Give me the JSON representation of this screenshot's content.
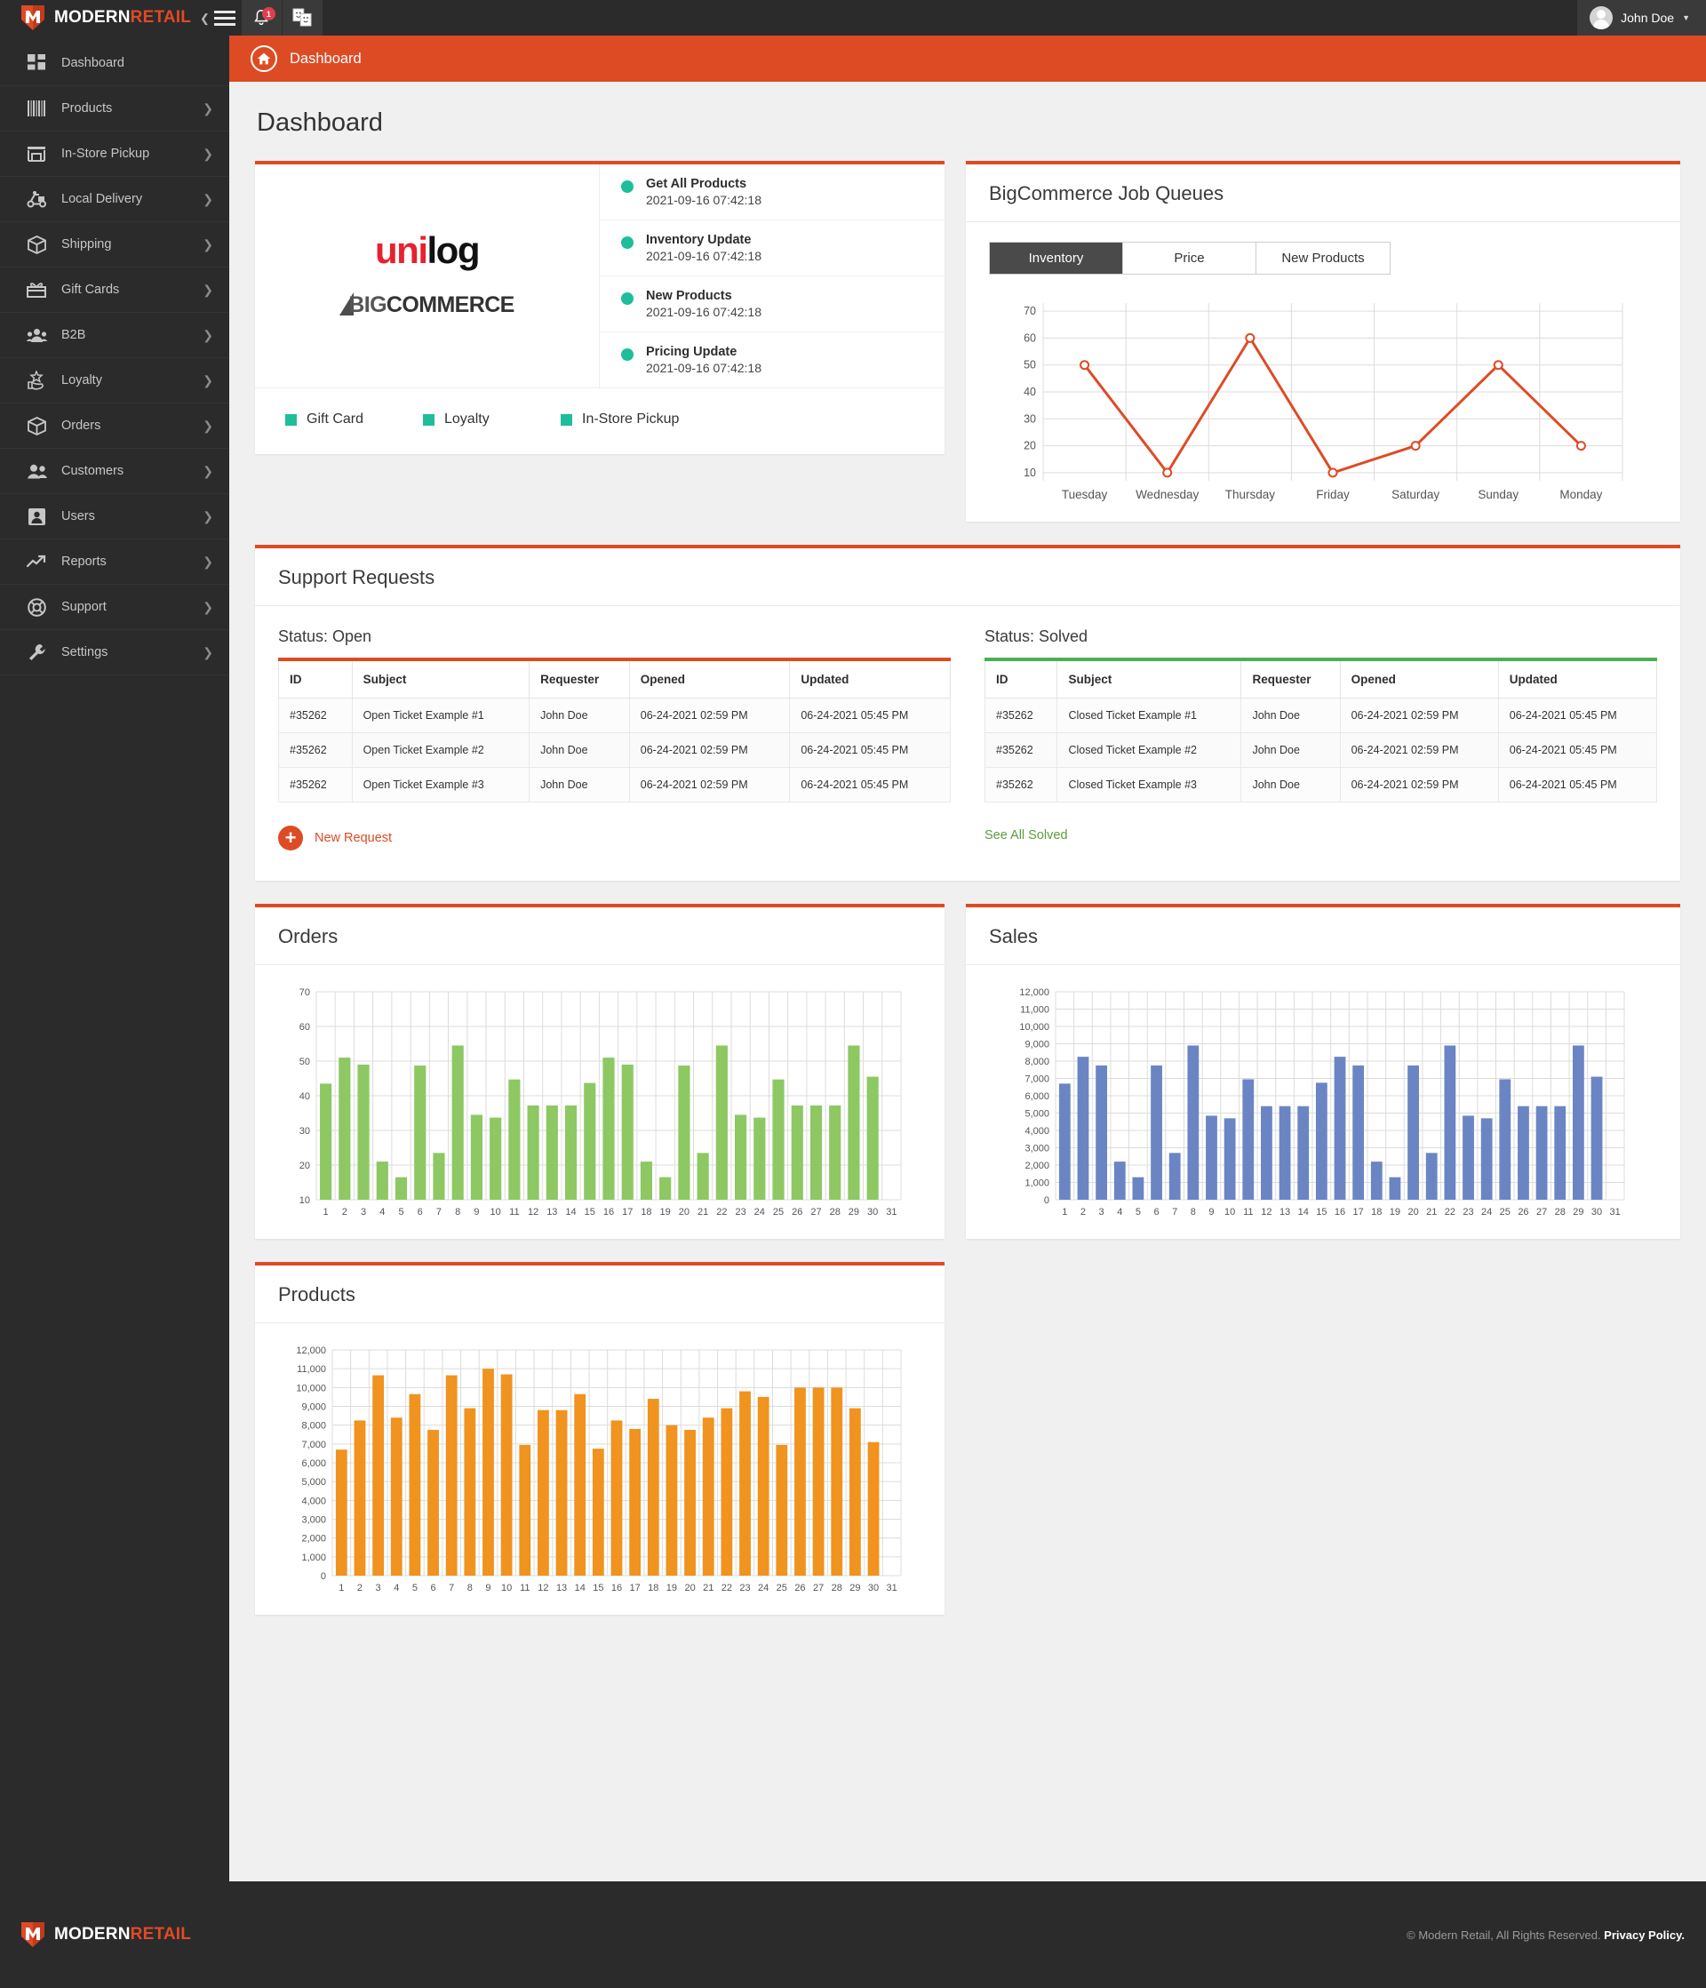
{
  "brand": {
    "word1": "MODERN",
    "word2": "RETAIL"
  },
  "topbar": {
    "notification_count": "1",
    "user_name": "John Doe",
    "notification_icon": "bell-icon",
    "apps_icon": "faces-icon",
    "menu_icon": "hamburger-icon"
  },
  "breadcrumb": {
    "label": "Dashboard"
  },
  "page": {
    "title": "Dashboard"
  },
  "sidebar": {
    "items": [
      {
        "label": "Dashboard",
        "icon": "grid-icon",
        "has_chevron": false
      },
      {
        "label": "Products",
        "icon": "barcode-icon",
        "has_chevron": true
      },
      {
        "label": "In-Store Pickup",
        "icon": "store-icon",
        "has_chevron": true
      },
      {
        "label": "Local Delivery",
        "icon": "scooter-icon",
        "has_chevron": true
      },
      {
        "label": "Shipping",
        "icon": "box-icon",
        "has_chevron": true
      },
      {
        "label": "Gift Cards",
        "icon": "gift-icon",
        "has_chevron": true
      },
      {
        "label": "B2B",
        "icon": "group-icon",
        "has_chevron": true
      },
      {
        "label": "Loyalty",
        "icon": "star-hand-icon",
        "has_chevron": true
      },
      {
        "label": "Orders",
        "icon": "package-icon",
        "has_chevron": true
      },
      {
        "label": "Customers",
        "icon": "people-icon",
        "has_chevron": true
      },
      {
        "label": "Users",
        "icon": "user-card-icon",
        "has_chevron": true
      },
      {
        "label": "Reports",
        "icon": "trend-up-icon",
        "has_chevron": true
      },
      {
        "label": "Support",
        "icon": "lifebuoy-icon",
        "has_chevron": true
      },
      {
        "label": "Settings",
        "icon": "wrench-icon",
        "has_chevron": true
      }
    ]
  },
  "status_card": {
    "logo_unilog_a": "uni",
    "logo_unilog_b": "log",
    "logo_bigcommerce_light": "BIG",
    "logo_bigcommerce_bold": "COMMERCE",
    "jobs": [
      {
        "name": "Get All Products",
        "time": "2021-09-16 07:42:18",
        "status_color": "#1fbe9a"
      },
      {
        "name": "Inventory Update",
        "time": "2021-09-16 07:42:18",
        "status_color": "#1fbe9a"
      },
      {
        "name": "New Products",
        "time": "2021-09-16 07:42:18",
        "status_color": "#1fbe9a"
      },
      {
        "name": "Pricing Update",
        "time": "2021-09-16 07:42:18",
        "status_color": "#1fbe9a"
      }
    ],
    "legend": [
      {
        "label": "Gift Card",
        "color": "#1fbe9a"
      },
      {
        "label": "Loyalty",
        "color": "#1fbe9a"
      },
      {
        "label": "In-Store Pickup",
        "color": "#1fbe9a"
      }
    ]
  },
  "job_queues": {
    "title": "BigCommerce Job Queues",
    "tabs": [
      {
        "label": "Inventory",
        "active": true
      },
      {
        "label": "Price",
        "active": false
      },
      {
        "label": "New Products",
        "active": false
      }
    ]
  },
  "support": {
    "title": "Support Requests",
    "open": {
      "status_label": "Status: Open",
      "columns": [
        "ID",
        "Subject",
        "Requester",
        "Opened",
        "Updated"
      ],
      "rows": [
        {
          "id": "#35262",
          "subject": "Open Ticket Example #1",
          "requester": "John Doe",
          "opened": "06-24-2021  02:59 PM",
          "updated": "06-24-2021  05:45 PM"
        },
        {
          "id": "#35262",
          "subject": "Open Ticket Example #2",
          "requester": "John Doe",
          "opened": "06-24-2021  02:59 PM",
          "updated": "06-24-2021  05:45 PM"
        },
        {
          "id": "#35262",
          "subject": "Open Ticket Example #3",
          "requester": "John Doe",
          "opened": "06-24-2021  02:59 PM",
          "updated": "06-24-2021  05:45 PM"
        }
      ],
      "action_label": "New Request"
    },
    "solved": {
      "status_label": "Status: Solved",
      "columns": [
        "ID",
        "Subject",
        "Requester",
        "Opened",
        "Updated"
      ],
      "rows": [
        {
          "id": "#35262",
          "subject": "Closed Ticket Example #1",
          "requester": "John Doe",
          "opened": "06-24-2021  02:59 PM",
          "updated": "06-24-2021  05:45 PM"
        },
        {
          "id": "#35262",
          "subject": "Closed Ticket Example #2",
          "requester": "John Doe",
          "opened": "06-24-2021  02:59 PM",
          "updated": "06-24-2021  05:45 PM"
        },
        {
          "id": "#35262",
          "subject": "Closed Ticket Example #3",
          "requester": "John Doe",
          "opened": "06-24-2021  02:59 PM",
          "updated": "06-24-2021  05:45 PM"
        }
      ],
      "action_label": "See All Solved"
    }
  },
  "sections": {
    "orders_title": "Orders",
    "sales_title": "Sales",
    "products_title": "Products"
  },
  "footer": {
    "copy": "© Modern Retail, All Rights Reserved.",
    "privacy": "Privacy Policy."
  },
  "colors": {
    "accent": "#dd4b25",
    "green": "#4caf50",
    "teal": "#1fbe9a",
    "orders_bar": "#8dc863",
    "sales_bar": "#6b85c4",
    "products_bar": "#f0931f",
    "line": "#dd4b25"
  },
  "chart_data": [
    {
      "id": "job_queues_line",
      "type": "line",
      "title": "BigCommerce Job Queues",
      "series_name": "Inventory",
      "categories": [
        "Tuesday",
        "Wednesday",
        "Thursday",
        "Friday",
        "Saturday",
        "Sunday",
        "Monday"
      ],
      "values": [
        50,
        10,
        60,
        10,
        20,
        50,
        20
      ],
      "yticks": [
        10,
        20,
        30,
        40,
        50,
        60,
        70
      ],
      "ylim": [
        7,
        73
      ],
      "xlabel": "",
      "ylabel": "",
      "grid": true,
      "legend": "none",
      "color": "#dd4b25"
    },
    {
      "id": "orders_bar",
      "type": "bar",
      "title": "Orders",
      "categories": [
        "1",
        "2",
        "3",
        "4",
        "5",
        "6",
        "7",
        "8",
        "9",
        "10",
        "11",
        "12",
        "13",
        "14",
        "15",
        "16",
        "17",
        "18",
        "19",
        "20",
        "21",
        "22",
        "23",
        "24",
        "25",
        "26",
        "27",
        "28",
        "29",
        "30",
        "31"
      ],
      "values": [
        43.5,
        51,
        49,
        21,
        16.5,
        48.7,
        23.5,
        54.5,
        34.5,
        33.7,
        44.7,
        37.2,
        37.2,
        37.2,
        43.7,
        51,
        49,
        21,
        16.5,
        48.7,
        23.5,
        54.5,
        34.5,
        33.7,
        44.7,
        37.2,
        37.2,
        37.2,
        54.5,
        45.5
      ],
      "yticks": [
        10,
        20,
        30,
        40,
        50,
        60,
        70
      ],
      "ylim": [
        10,
        70
      ],
      "xlabel": "",
      "ylabel": "",
      "grid": true,
      "legend": "none",
      "color": "#8dc863"
    },
    {
      "id": "sales_bar",
      "type": "bar",
      "title": "Sales",
      "categories": [
        "1",
        "2",
        "3",
        "4",
        "5",
        "6",
        "7",
        "8",
        "9",
        "10",
        "11",
        "12",
        "13",
        "14",
        "15",
        "16",
        "17",
        "18",
        "19",
        "20",
        "21",
        "22",
        "23",
        "24",
        "25",
        "26",
        "27",
        "28",
        "29",
        "30",
        "31"
      ],
      "values": [
        6700,
        8250,
        7750,
        2200,
        1300,
        7750,
        2700,
        8900,
        4850,
        4700,
        6950,
        5400,
        5400,
        5400,
        6750,
        8250,
        7750,
        2200,
        1300,
        7750,
        2700,
        8900,
        4850,
        4700,
        6950,
        5400,
        5400,
        5400,
        8900,
        7100
      ],
      "yticks": [
        0,
        1000,
        2000,
        3000,
        4000,
        5000,
        6000,
        7000,
        8000,
        9000,
        10000,
        11000,
        12000
      ],
      "ytick_labels": [
        "0",
        "1,000",
        "2,000",
        "3,000",
        "4,000",
        "5,000",
        "6,000",
        "7,000",
        "8,000",
        "9,000",
        "10,000",
        "11,000",
        "12,000"
      ],
      "ylim": [
        0,
        12000
      ],
      "xlabel": "",
      "ylabel": "",
      "grid": true,
      "legend": "none",
      "color": "#6b85c4"
    },
    {
      "id": "products_bar",
      "type": "bar",
      "title": "Products",
      "categories": [
        "1",
        "2",
        "3",
        "4",
        "5",
        "6",
        "7",
        "8",
        "9",
        "10",
        "11",
        "12",
        "13",
        "14",
        "15",
        "16",
        "17",
        "18",
        "19",
        "20",
        "21",
        "22",
        "23",
        "24",
        "25",
        "26",
        "27",
        "28",
        "29",
        "30",
        "31"
      ],
      "values": [
        6700,
        8250,
        10650,
        8400,
        9650,
        7750,
        10650,
        8900,
        11000,
        10700,
        6950,
        8800,
        8800,
        9650,
        6750,
        8250,
        7800,
        9400,
        8000,
        7750,
        8400,
        8900,
        9800,
        9500,
        6950,
        10000,
        10000,
        10000,
        8900,
        7100
      ],
      "yticks": [
        0,
        1000,
        2000,
        3000,
        4000,
        5000,
        6000,
        7000,
        8000,
        9000,
        10000,
        11000,
        12000
      ],
      "ytick_labels": [
        "0",
        "1,000",
        "2,000",
        "3,000",
        "4,000",
        "5,000",
        "6,000",
        "7,000",
        "8,000",
        "9,000",
        "10,000",
        "11,000",
        "12,000"
      ],
      "ylim": [
        0,
        12000
      ],
      "xlabel": "",
      "ylabel": "",
      "grid": true,
      "legend": "none",
      "color": "#f0931f"
    }
  ]
}
